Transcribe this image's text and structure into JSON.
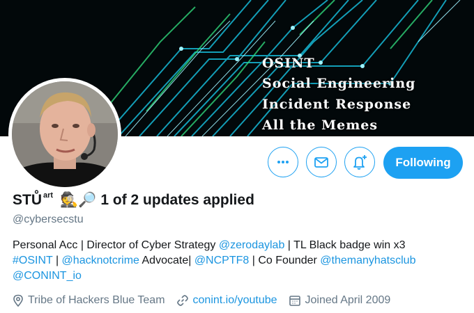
{
  "banner": {
    "lines": [
      "OSINT",
      "Social Engineering",
      "Incident Response",
      "All the Memes"
    ]
  },
  "actions": {
    "more_icon": "more-icon",
    "message_icon": "envelope-icon",
    "notify_icon": "bell-plus-icon",
    "follow_label": "Following"
  },
  "profile": {
    "name_main": "STŮ",
    "name_sup": "art",
    "name_emoji": "🕵🔎",
    "name_status": "1 of 2 updates applied",
    "handle": "@cybersecstu"
  },
  "bio": {
    "p1": "Personal Acc | Director of Cyber Strategy ",
    "l1": "@zerodaylab",
    "p2": " | TL Black badge win x3",
    "l2": "#OSINT",
    "p3": " | ",
    "l3": "@hacknotcrime",
    "p4": " Advocate| ",
    "l4": "@NCPTF8",
    "p5": " | Co Founder ",
    "l5": "@themanyhatsclub",
    "l6": "@CONINT_io"
  },
  "meta": {
    "location": "Tribe of Hackers Blue Team",
    "website": "conint.io/youtube",
    "joined": "Joined April 2009"
  },
  "colors": {
    "accent": "#1da1f2",
    "link": "#1b95e0",
    "muted": "#657786",
    "banner_bg": "#02080a",
    "banner_glow": "#18c7e0"
  }
}
